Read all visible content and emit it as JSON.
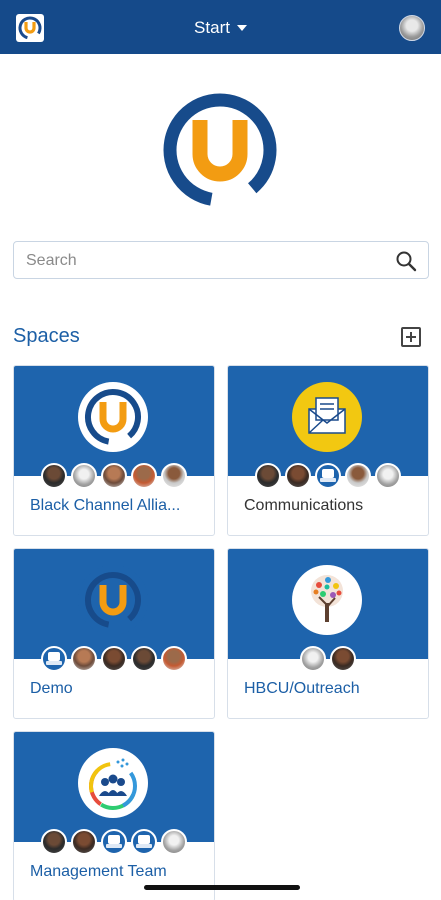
{
  "header": {
    "start_label": "Start"
  },
  "search": {
    "placeholder": "Search"
  },
  "spaces": {
    "title": "Spaces",
    "cards": [
      {
        "name": "Black Channel Allia...",
        "icon": "u-logo-icon"
      },
      {
        "name": "Communications",
        "icon": "envelope-icon"
      },
      {
        "name": "Demo",
        "icon": "u-logo-icon"
      },
      {
        "name": "HBCU/Outreach",
        "icon": "tree-icon"
      },
      {
        "name": "Management Team",
        "icon": "team-icon"
      }
    ]
  },
  "colors": {
    "header": "#154a8a",
    "accent": "#1c5fa6",
    "brand_orange": "#f39c12",
    "card_banner": "#1e64ad"
  }
}
